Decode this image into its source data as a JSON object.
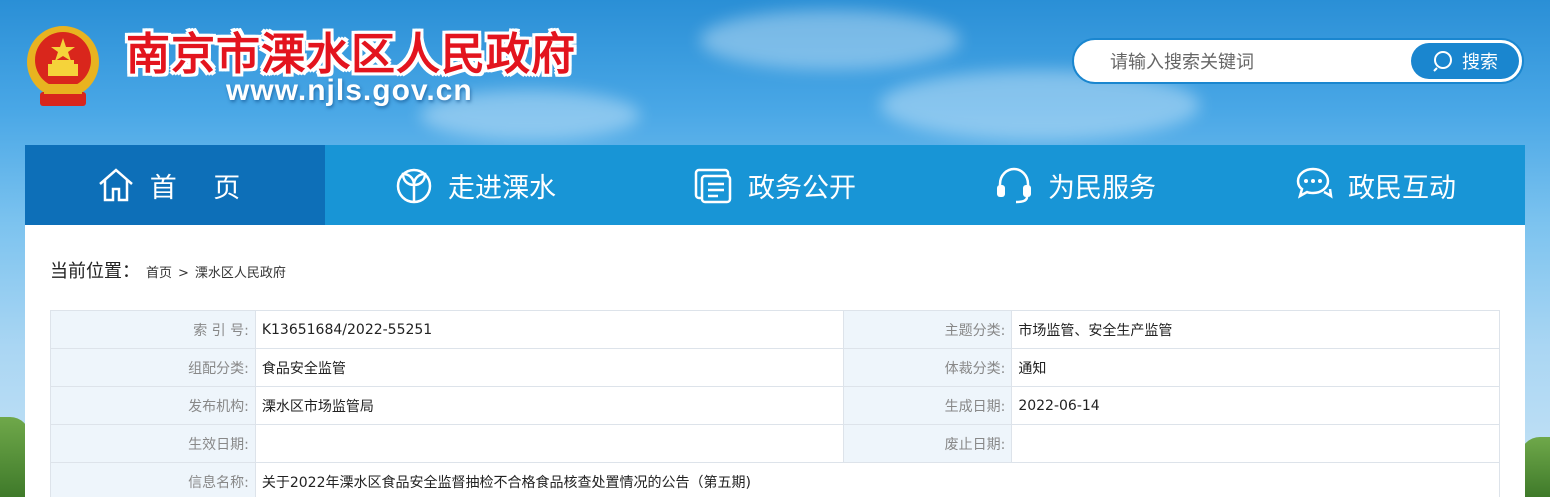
{
  "header": {
    "site_title": "南京市溧水区人民政府",
    "site_url": "www.njls.gov.cn"
  },
  "search": {
    "placeholder": "请输入搜索关键词",
    "button_label": "搜索"
  },
  "nav": {
    "items": [
      {
        "label": "首 页",
        "icon": "home-icon"
      },
      {
        "label": "走进溧水",
        "icon": "sprout-icon"
      },
      {
        "label": "政务公开",
        "icon": "document-icon"
      },
      {
        "label": "为民服务",
        "icon": "headset-icon"
      },
      {
        "label": "政民互动",
        "icon": "chat-icon"
      }
    ]
  },
  "breadcrumb": {
    "title": "当前位置：",
    "items": [
      "首页",
      "溧水区人民政府"
    ],
    "separator": ">"
  },
  "meta": {
    "index_no_label": "索 引 号:",
    "index_no": "K13651684/2022-55251",
    "topic_label": "主题分类:",
    "topic": "市场监管、安全生产监管",
    "org_cat_label": "组配分类:",
    "org_cat": "食品安全监管",
    "genre_label": "体裁分类:",
    "genre": "通知",
    "publisher_label": "发布机构:",
    "publisher": "溧水区市场监管局",
    "created_label": "生成日期:",
    "created": "2022-06-14",
    "effective_label": "生效日期:",
    "effective": "",
    "expired_label": "废止日期:",
    "expired": "",
    "name_label": "信息名称:",
    "name": "关于2022年溧水区食品安全监督抽检不合格食品核查处置情况的公告（第五期)"
  },
  "colors": {
    "nav_bg": "#1895d6",
    "nav_active": "#0d6fb8",
    "title_red": "#e3141e",
    "label_bg": "#eef5fb"
  }
}
